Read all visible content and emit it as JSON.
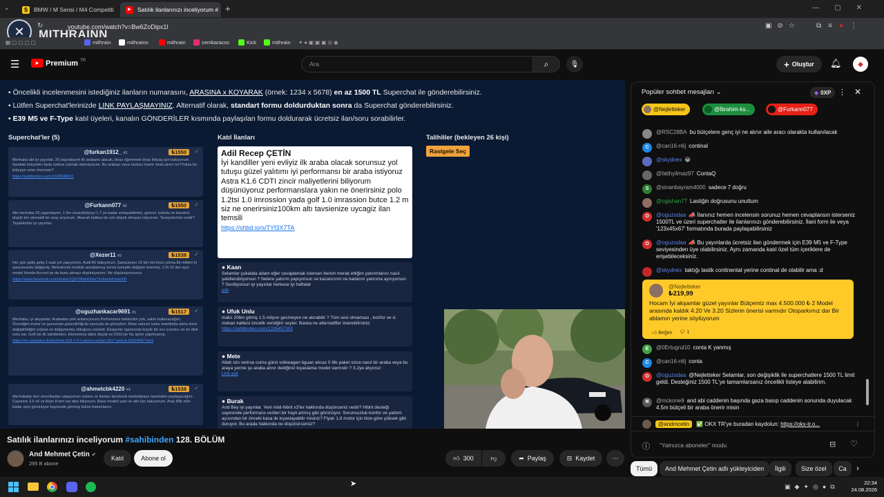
{
  "browser": {
    "tabs": [
      {
        "title": "BMW / M Serisi / M4 Competiti",
        "active": false,
        "fav_color": "#f5c518",
        "fav_glyph": "S"
      },
      {
        "title": "Satılık ilanlarınızı inceliyorum #",
        "active": true,
        "fav_color": "#ff0000",
        "fav_glyph": "▶"
      }
    ],
    "new_tab": "+",
    "url": "youtube.com/watch?v=Bw6ZoDipx1I",
    "overlay_logo": "MITHRAINN",
    "bookmarks": [
      {
        "label": "mithrain",
        "color": "#5865f2"
      },
      {
        "label": "mithrainn",
        "color": "#ffffff"
      },
      {
        "label": "mithrain",
        "color": "#ff0000"
      },
      {
        "label": "cemkaracoc",
        "color": "#e1306c"
      },
      {
        "label": "Kick",
        "color": "#53fc18"
      },
      {
        "label": "mithrain",
        "color": "#53fc18"
      }
    ]
  },
  "youtube": {
    "logo": "Premium",
    "logo_sup": "TR",
    "search_placeholder": "Ara",
    "create_label": "Oluştur",
    "video": {
      "rules": [
        {
          "pre": "• Öncelikli incelenmesini istediğiniz ilanların numarasını, ",
          "u": "ARASINA x KOYARAK",
          "mid": " (örnek: 1234 x 5678) ",
          "b": "en az 1500 TL",
          "post": " Superchat ile gönderebilirsiniz."
        },
        {
          "pre": "• Lütfen Superchat'lerinizde ",
          "u": "LINK PAYLAŞMAYINIZ",
          "mid": ". Alternatif olarak, ",
          "b": "standart formu doldurduktan sonra",
          "post": " da Superchat gönderebilirsiniz."
        },
        {
          "pre": "",
          "u": "",
          "mid": "",
          "b": "• E39 M5 ve F-Type",
          "post": " katıl üyeleri, kanalın GÖNDERİLER kısmında paylaşılan formu doldurarak ücretsiz ilan/soru sorabilirler."
        }
      ],
      "col_superchats": "Superchat'ler (5)",
      "col_listings": "Katıl İlanları",
      "col_applicants": "Talihliler (bekleyen 26 kişi)",
      "random_button": "Rastgele Seç",
      "superchats": [
        {
          "name": "@furkan1912_",
          "num": "#2",
          "amount": "₺1550",
          "text": "Merhaba abi iyi yayınlar, 25 yaşındayım ilk arabamı alacak, biraz öğrenmek biraz ihtiyaç için bakıyorum. İlandaki bütçeden fazla üstüne çıkmak istemiyorum. Bu arabayı veya motoru önerir misin,alınır mı?Yoksa bu bütçeye neler önerirsin?",
          "link": "https://sahibinden.com/1335848431"
        },
        {
          "name": "@Furkann077",
          "num": "#5",
          "amount": "₺1550",
          "text": "Abi merhaba 26 yaşındayım, 1.5m civarı(bütçeyi 1.7 ye kadar zorlayabilirim), güncel, turbolu ve benzinli, düşük km otomatik bir araç arıyorum. Masrafı kalitesi de çok düşük olmasın istiyorum. Tavsiyeleriniz nedir? Teşekkürler iyi yayınlar.",
          "link": ""
        },
        {
          "name": "@Xezer11",
          "num": "#3",
          "amount": "₺1538",
          "text": "Her gün gidiş geliş 2 saat yol yapıyorum. Audi A5 bakıyorum. Şanzumanı 10 bin mil önce çıkma 8k milden ki şanzumanla değişmiş. Mekatronik modülü anzalanmış servis kompile değişim önermiş. 2.0t 10 ileri aynı model Honda Accord ya da bunu almayı düşünüyorum. Ne düşünüyorsunuz",
          "link": "https://www.facebook.com/share/1Q6VWpHDHp/?mibextid=wwXIfr"
        },
        {
          "name": "@oguzhankacar9691",
          "num": "#1",
          "amount": "₺1517",
          "text": "Merhaba, iyi akşamlar. Arabadan pek anlamıyorum.Performans beklentim yok, sakin kullanacağım. Önceliğim motor ve şanzıman güvenilirliği,iki satıcıyla da görüştüm. Bmw satıcısı turbo manifoldu daha önce değiştirildiğini orijinal ve değişmemiş olduğunu söyledi. Ekspertiz raporunda küçük bir sıvı sızıntısı ve ön disk notu var. Golf ise ilk sahibinden, kilometresi daha düşük ve DSG'yle hiç işlem yapılmamış.",
          "link": "https://en.autoplius.lt/ads/bmw-318-1-5-l-saloon-sedan-2017-petrol-31604097.html"
        },
        {
          "name": "@ahmetcbk4220",
          "num": "#4",
          "amount": "₺1538",
          "text": "Merhabalar ben amerikadan ulaşıyorum sizlere ve ilanları facebook marketplace üzerinden paylaşacağım. Cayenne 3.6 v6 ve Aisin 8 ileri var diye biliyorum. Base modeli yani ve aile için bakıyorum. Araç 80k mile kadar aynı görünüyor bayisinde görmüş bütün bakımlarını.",
          "link": ""
        }
      ],
      "featured": {
        "name": "Adil Recep ÇETİN",
        "text": "İyi kandiller yeni evliyiz ilk araba olacak sorunsuz yol tutuşu güzel yalıtımı iyi performansı bir araba istiyoruz Astra K1.6 CDTI zincir maliyetlerini biliyorum düşünüyoruz performanslara yakın ne önerirsiniz polo 1.2tsi 1.0 imrossion yada golf 1.0 imrassion butce 1.2 m siz ne onerirsiniz100km altı tavsienize uycagiz ilan temsili",
        "link": "https://shbd.io/s/TYf3X7TA"
      },
      "listings": [
        {
          "name": "Kaan",
          "text": "Selamlar çukalata adam eğer cevaplamak istersen benim merak ettiğim yatırımlarını nasıl şekillendiriyorsun ? Nelere yatırım yapıyorsun ve kazancının ne kadarını yatırıma ayırıyorsun ? Seviliyorsun iyi yayınlar herkese iyi haftalar",
          "link": "yok"
        },
        {
          "name": "Ufuk Unlu",
          "text": "maks 20bin gitmiş 1.5 milyon gecmeyen ne alınabilir ? Trim sesi olmaması , konfor ve ic mekan kalitesi öncelik verdiğim seyler. Baska ne alternatifler önerebilirsiniz",
          "link": "https://sahibinden.com/1335457300"
        },
        {
          "name": "Mete",
          "text": "Allah izin verirse cuma günü volkwagen tiguan alıcaz 0 life paket sizce nasıl bir araba veya bu araya yerine şu araba alınır dediğiniz kıyaslama model varmıdır ? 3.2ye alıyoruz",
          "link": "Link yok"
        },
        {
          "name": "Burak",
          "text": "And Bey iyi yayınlar. Yeni mild-hibrit x3'ler hakkında düşünceniz nedir? Hibrit desteği sayesinde performans verileri bir hayli artmış gibi görünüyor. Sorunsuzluk-konfor ve yalıtım açısından bir önceki kasa ile kıyaslayabilir misiniz? Fiyatı 1.8 motor için bize göre yüksek gibi duruyor. Bu arada hakkında ne düşünürsünüz?",
          "link": ""
        }
      ]
    },
    "title_pre": "Satılık ilanlarınızı inceliyorum ",
    "title_tag": "#sahibinden",
    "title_post": " 128. BÖLÜM",
    "channel": {
      "name": "And Mehmet Çetin",
      "subs": "295 B abone",
      "join": "Katıl",
      "subscribe": "Abone ol"
    },
    "actions": {
      "likes": "300",
      "share": "Paylaş",
      "save": "Kaydet"
    },
    "chat": {
      "header": "Popüler sohbet mesajları",
      "points": "0XP",
      "pinned": [
        {
          "name": "@Nejletteker",
          "color": "#f5c518",
          "text_color": "#111111"
        },
        {
          "name": "@İbrahim-ks...",
          "color": "#1e8e3e",
          "text_color": "#ffffff"
        },
        {
          "name": "@Furkann077",
          "color": "#e62117",
          "text_color": "#ffffff"
        }
      ],
      "messages": [
        {
          "author": "@RSC28BA",
          "text": "bu bütçelere genç iyi ne alınır aile aracı olarakta kullanılacak",
          "av": "#888888",
          "type": ""
        },
        {
          "author": "@can16-n6j",
          "text": "continal",
          "av": "#1e88e5",
          "type": ""
        },
        {
          "author": "@skydnex",
          "text": "😀",
          "av": "#5c6bc0",
          "type": "mod"
        },
        {
          "author": "@fatihyilmaz97",
          "text": "ContaQ",
          "av": "#666666",
          "type": ""
        },
        {
          "author": "@sinanbayram4000",
          "text": "sadece 7 doğru",
          "av": "#2e7d32",
          "type": ""
        },
        {
          "author": "@ogishan77",
          "text": "Lastiğin doğrusunu unuttum",
          "av": "#8d6e63",
          "type": "member"
        },
        {
          "author": "@oguzodaa",
          "text": "📣 İlanınız hemen incelensin sorunuz hemen cevaplansın isterseniz 1500TL ve üzeri superchatler ile ilanlarınızı gönderebilirsiniz. İlani form ile veya '123x45x67' formatında burada paylaşabilirsiniz",
          "av": "#d32f2f",
          "type": "mod"
        },
        {
          "author": "@oguzodaa",
          "text": "📣 Bu yayınlarda ücretsiz ilan göndermek için E39 M5 ve F-Type seviyesinden üye olabilirsiniz. Aynı zamanda katıl özel tüm içeriklere de erişebileceksiniz.",
          "av": "#d32f2f",
          "type": "mod"
        },
        {
          "author": "@skydnex",
          "text": "taktığı lastik continental yerine continal de olabilir ama :d",
          "av": "#c62828",
          "type": "mod"
        },
        {
          "author": "@0Ertugrul10",
          "text": "conta K yanmış",
          "av": "#43a047",
          "type": ""
        },
        {
          "author": "@can16-n6j",
          "text": "conta",
          "av": "#1e88e5",
          "type": ""
        },
        {
          "author": "@oguzodaa",
          "text": "@Nejletteker Selamlar, son değişiklik ile superchatlere 1500 TL limit geldi. Desteğiniz 1500 TL'ye tamamlarsanız öncelikli listeye alabilirim.",
          "av": "#d32f2f",
          "type": "mod"
        },
        {
          "author": "@mckone9",
          "text": "and abi caddenin başında gaza basıp caddenin sonunda duyulacak 4.5m bütçeli bir araba önerir misin",
          "av": "#555555",
          "type": ""
        }
      ],
      "superchat": {
        "author": "@Nejletteker",
        "amount": "₺219,99",
        "text": "Hocam İyi akşamlar güzel yayınlar Bütçemiz max 4.500.000 ₺ 2 Model arasında kaldık 4.20 Ve 3.20 Sizlerin önerisi varmıdır Otoparkımız dar Bir ablamın yerine söylüyorum",
        "like": "Beğen",
        "replies": "1"
      },
      "ticker_author": "@andmcetin",
      "ticker_text": "✅ OKX TR'ye buradan kaydolun: ",
      "ticker_link": "https://okx-tr.o...",
      "mode": "\"Yalnızca aboneler\" modu"
    },
    "chips": [
      "Tümü",
      "And Mehmet Çetin adlı yükleyiciden",
      "İlgili",
      "Size özel",
      "Ca"
    ]
  },
  "taskbar": {
    "time": "22:34",
    "date": "24.08.2026"
  }
}
